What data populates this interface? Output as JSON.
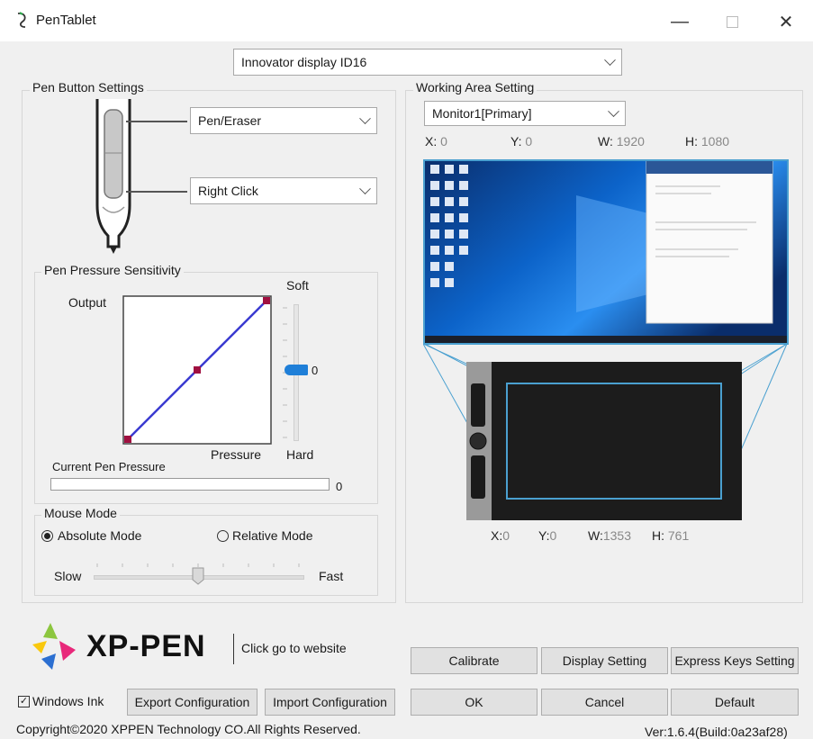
{
  "window": {
    "title": "PenTablet",
    "app_icon": "pentablet-icon"
  },
  "device": {
    "selected": "Innovator display ID16"
  },
  "pen_buttons": {
    "title": "Pen Button Settings",
    "upper": "Pen/Eraser",
    "lower": "Right Click"
  },
  "pressure": {
    "title": "Pen Pressure Sensitivity",
    "output_label": "Output",
    "pressure_label": "Pressure",
    "soft_label": "Soft",
    "hard_label": "Hard",
    "slider_value": "0",
    "current_label": "Current Pen Pressure",
    "current_value": "0",
    "curve_color": "#3a3ad0",
    "point_color": "#a01040"
  },
  "mouse_mode": {
    "title": "Mouse Mode",
    "absolute": "Absolute Mode",
    "relative": "Relative Mode",
    "selected": "absolute",
    "slow": "Slow",
    "fast": "Fast"
  },
  "working_area": {
    "title": "Working Area Setting",
    "monitor": "Monitor1[Primary]",
    "screen": {
      "x_label": "X:",
      "x": "0",
      "y_label": "Y:",
      "y": "0",
      "w_label": "W:",
      "w": "1920",
      "h_label": "H:",
      "h": "1080"
    },
    "tablet": {
      "x_label": "X:",
      "x": "0",
      "y_label": "Y:",
      "y": "0",
      "w_label": "W:",
      "w": "1353",
      "h_label": "H:",
      "h": "761"
    },
    "area_color": "#4aa0d0"
  },
  "logo": {
    "brand": "XP-PEN",
    "link": "Click go to website"
  },
  "buttons": {
    "calibrate": "Calibrate",
    "display_setting": "Display Setting",
    "express_keys": "Express Keys Setting",
    "export": "Export Configuration",
    "import": "Import Configuration",
    "ok": "OK",
    "cancel": "Cancel",
    "default": "Default"
  },
  "windows_ink": {
    "label": "Windows Ink",
    "checked": true
  },
  "footer": {
    "copyright": "Copyright©2020 XPPEN Technology CO.All Rights Reserved.",
    "version": "Ver:1.6.4(Build:0a23af28)"
  }
}
